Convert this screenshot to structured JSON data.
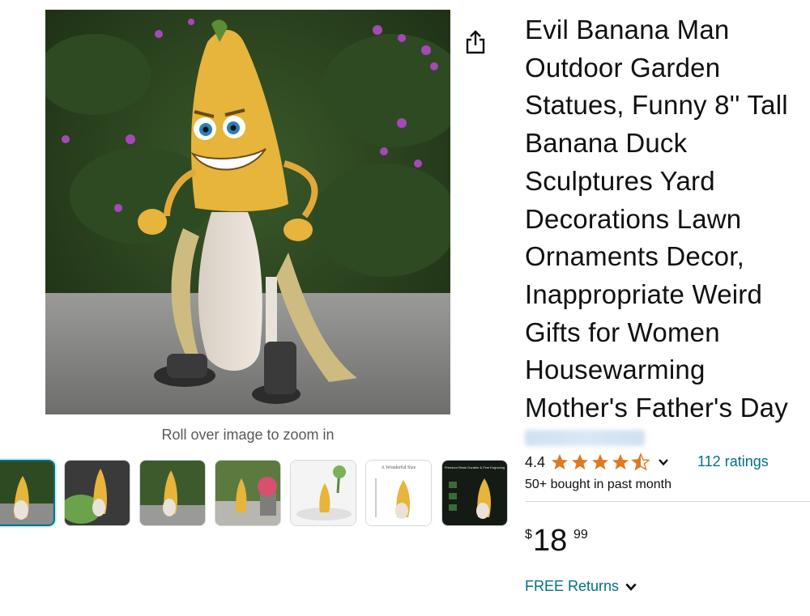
{
  "product": {
    "title": "Evil Banana Man Outdoor Garden Statues, Funny 8'' Tall Banana Duck Sculptures Yard Decorations Lawn Ornaments Decor, Inappropriate Weird Gifts for Women Housewarming Mother's Father's Day"
  },
  "gallery": {
    "main_image": "banana-man-statue-photo",
    "zoom_hint": "Roll over image to zoom in",
    "share_icon": "share-icon",
    "thumbnails": [
      {
        "name": "thumbnail-1",
        "selected": true,
        "caption": ""
      },
      {
        "name": "thumbnail-2",
        "selected": false,
        "caption": ""
      },
      {
        "name": "thumbnail-3",
        "selected": false,
        "caption": ""
      },
      {
        "name": "thumbnail-4",
        "selected": false,
        "caption": ""
      },
      {
        "name": "thumbnail-5",
        "selected": false,
        "caption": ""
      },
      {
        "name": "thumbnail-6",
        "selected": false,
        "caption": "A Wonderful Size"
      },
      {
        "name": "thumbnail-7",
        "selected": false,
        "caption": "Premium Resin Durable & Fine Engraving"
      }
    ]
  },
  "rating": {
    "value": "4.4",
    "stars_filled": 4.4,
    "stars_total": 5,
    "count_label": "112 ratings",
    "star_color": "#de7921"
  },
  "social_proof": {
    "bought_label": "50+ bought in past month"
  },
  "price": {
    "symbol": "$",
    "whole": "18",
    "fraction": "99"
  },
  "shipping": {
    "free_returns_label": "FREE Returns"
  },
  "colors": {
    "link": "#007185",
    "text": "#0f1111",
    "selected_thumb_border": "#007185"
  }
}
